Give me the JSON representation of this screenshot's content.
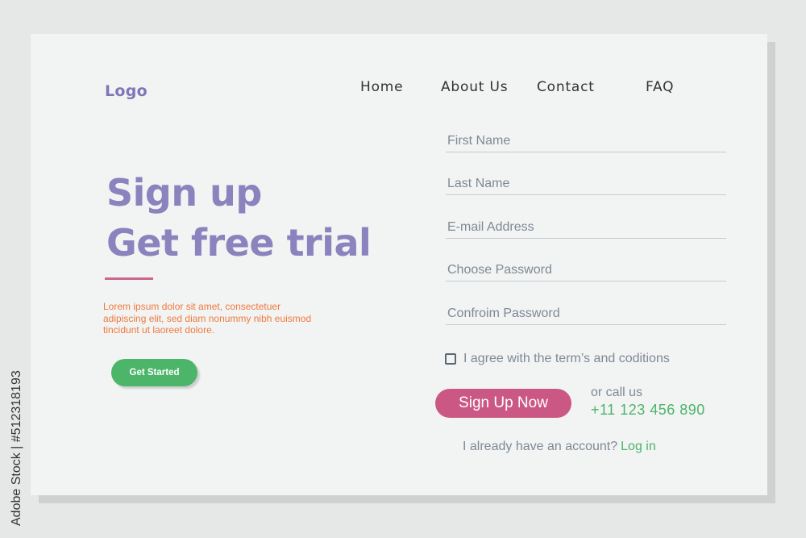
{
  "header": {
    "logo": "Logo",
    "nav": [
      "Home",
      "About Us",
      "Contact",
      "FAQ"
    ]
  },
  "hero": {
    "title_line1": "Sign up",
    "title_line2": "Get free trial",
    "description": "Lorem ipsum dolor sit amet, consectetuer adipiscing elit, sed diam nonummy nibh euismod tincidunt ut laoreet dolore.",
    "cta_label": "Get Started"
  },
  "form": {
    "fields": [
      {
        "placeholder": "First Name",
        "value": ""
      },
      {
        "placeholder": "Last Name",
        "value": ""
      },
      {
        "placeholder": "E-mail Address",
        "value": ""
      },
      {
        "placeholder": "Choose Password",
        "value": ""
      },
      {
        "placeholder": "Confroim Password",
        "value": ""
      }
    ],
    "agree_label": "I agree with the term’s and coditions",
    "agree_checked": false,
    "submit_label": "Sign Up Now",
    "call_label": "or call us",
    "phone": "+11 123 456 890",
    "account_text": "I already have an account?",
    "login_label": "Log in"
  },
  "watermark": {
    "side_text": "Adobe Stock | #512318193"
  },
  "colors": {
    "purple": "#8a83bd",
    "pink": "#cb5884",
    "green": "#4cb56a",
    "orange": "#f07a3e",
    "card": "#f2f3f3"
  }
}
